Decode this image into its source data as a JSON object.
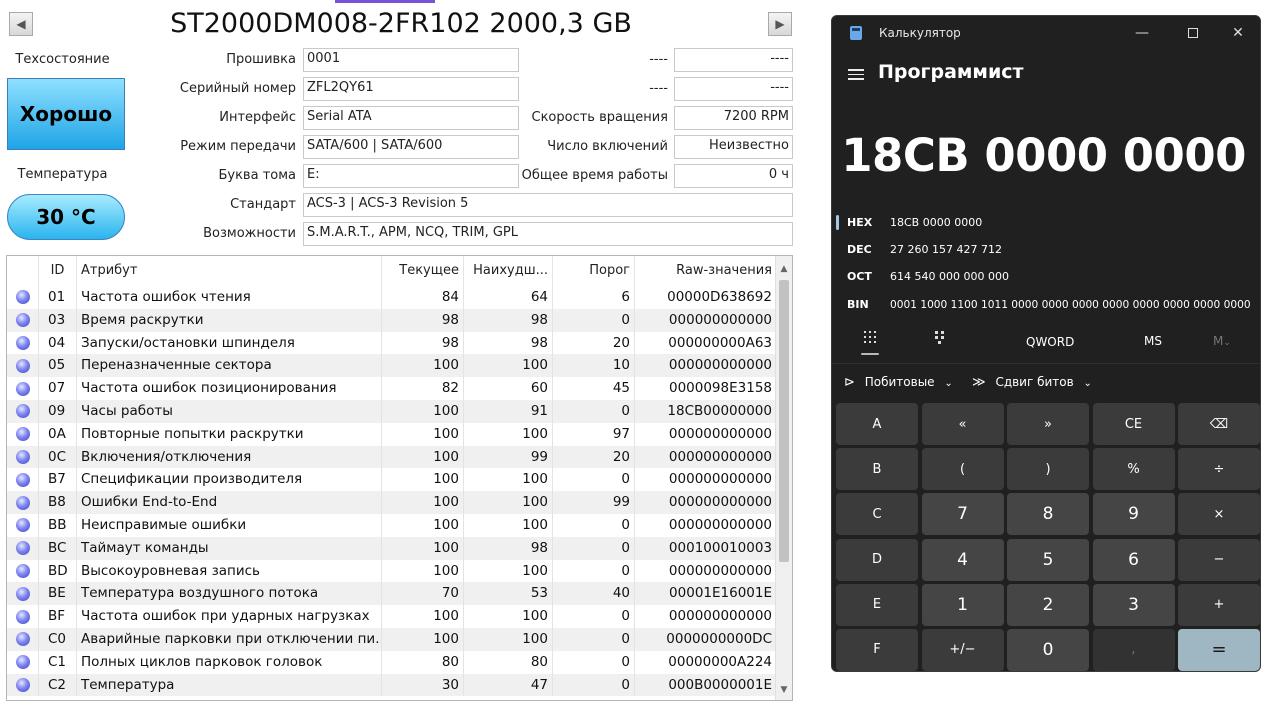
{
  "cdi": {
    "prev_label": "◀",
    "next_label": "▶",
    "drive_title": "ST2000DM008-2FR102 2000,3 GB",
    "health_label": "Техсостояние",
    "health_value": "Хорошо",
    "temp_label": "Температура",
    "temp_value": "30 °C",
    "fields": {
      "firmware_label": "Прошивка",
      "firmware": "0001",
      "serial_label": "Серийный номер",
      "serial": "ZFL2QY61",
      "interface_label": "Интерфейс",
      "interface": "Serial ATA",
      "transfer_label": "Режим передачи",
      "transfer": "SATA/600 | SATA/600",
      "letter_label": "Буква тома",
      "letter": "E:",
      "standard_label": "Стандарт",
      "standard": "ACS-3 | ACS-3 Revision 5",
      "features_label": "Возможности",
      "features": "S.M.A.R.T., APM, NCQ, TRIM, GPL",
      "r1_label": "----",
      "r1": "----",
      "r2_label": "----",
      "r2": "----",
      "rpm_label": "Скорость вращения",
      "rpm": "7200 RPM",
      "power_count_label": "Число включений",
      "power_count": "Неизвестно",
      "power_hours_label": "Общее время работы",
      "power_hours": "0 ч"
    },
    "columns": {
      "id": "ID",
      "attribute": "Атрибут",
      "current": "Текущее",
      "worst": "Наихудш...",
      "threshold": "Порог",
      "raw": "Raw-значения"
    },
    "rows": [
      {
        "id": "01",
        "name": "Частота ошибок чтения",
        "cur": "84",
        "worst": "64",
        "thr": "6",
        "raw": "00000D638692"
      },
      {
        "id": "03",
        "name": "Время раскрутки",
        "cur": "98",
        "worst": "98",
        "thr": "0",
        "raw": "000000000000"
      },
      {
        "id": "04",
        "name": "Запуски/остановки шпинделя",
        "cur": "98",
        "worst": "98",
        "thr": "20",
        "raw": "000000000A63"
      },
      {
        "id": "05",
        "name": "Переназначенные сектора",
        "cur": "100",
        "worst": "100",
        "thr": "10",
        "raw": "000000000000"
      },
      {
        "id": "07",
        "name": "Частота ошибок позиционирования",
        "cur": "82",
        "worst": "60",
        "thr": "45",
        "raw": "0000098E3158"
      },
      {
        "id": "09",
        "name": "Часы работы",
        "cur": "100",
        "worst": "91",
        "thr": "0",
        "raw": "18CB00000000"
      },
      {
        "id": "0A",
        "name": "Повторные попытки раскрутки",
        "cur": "100",
        "worst": "100",
        "thr": "97",
        "raw": "000000000000"
      },
      {
        "id": "0C",
        "name": "Включения/отключения",
        "cur": "100",
        "worst": "99",
        "thr": "20",
        "raw": "000000000000"
      },
      {
        "id": "B7",
        "name": "Спецификации производителя",
        "cur": "100",
        "worst": "100",
        "thr": "0",
        "raw": "000000000000"
      },
      {
        "id": "B8",
        "name": "Ошибки End-to-End",
        "cur": "100",
        "worst": "100",
        "thr": "99",
        "raw": "000000000000"
      },
      {
        "id": "BB",
        "name": "Неисправимые ошибки",
        "cur": "100",
        "worst": "100",
        "thr": "0",
        "raw": "000000000000"
      },
      {
        "id": "BC",
        "name": "Таймаут команды",
        "cur": "100",
        "worst": "98",
        "thr": "0",
        "raw": "000100010003"
      },
      {
        "id": "BD",
        "name": "Высокоуровневая запись",
        "cur": "100",
        "worst": "100",
        "thr": "0",
        "raw": "000000000000"
      },
      {
        "id": "BE",
        "name": "Температура воздушного потока",
        "cur": "70",
        "worst": "53",
        "thr": "40",
        "raw": "00001E16001E"
      },
      {
        "id": "BF",
        "name": "Частота ошибок при ударных нагрузках",
        "cur": "100",
        "worst": "100",
        "thr": "0",
        "raw": "000000000000"
      },
      {
        "id": "C0",
        "name": "Аварийные парковки при отключении пи...",
        "cur": "100",
        "worst": "100",
        "thr": "0",
        "raw": "0000000000DC"
      },
      {
        "id": "C1",
        "name": "Полных циклов парковок головок",
        "cur": "80",
        "worst": "80",
        "thr": "0",
        "raw": "00000000A224"
      },
      {
        "id": "C2",
        "name": "Температура",
        "cur": "30",
        "worst": "47",
        "thr": "0",
        "raw": "000B0000001E"
      }
    ]
  },
  "calc": {
    "title": "Калькулятор",
    "mode": "Программист",
    "display": "18CB 0000 0000",
    "radix": [
      {
        "name": "HEX",
        "value": "18CB 0000 0000"
      },
      {
        "name": "DEC",
        "value": "27 260 157 427 712"
      },
      {
        "name": "OCT",
        "value": "614 540 000 000 000"
      },
      {
        "name": "BIN",
        "value": "0001 1000 1100 1011 0000 0000 0000 0000 0000 0000 0000 0000"
      }
    ],
    "word_size": "QWORD",
    "ms_label": "MS",
    "m_menu_label": "M",
    "bitwise_label": "Побитовые",
    "shift_label": "Сдвиг битов",
    "keys": [
      "A",
      "«",
      "»",
      "CE",
      "⌫",
      "B",
      "(",
      ")",
      "%",
      "÷",
      "C",
      "7",
      "8",
      "9",
      "×",
      "D",
      "4",
      "5",
      "6",
      "−",
      "E",
      "1",
      "2",
      "3",
      "+",
      "F",
      "+/−",
      "0",
      ",",
      "="
    ]
  }
}
